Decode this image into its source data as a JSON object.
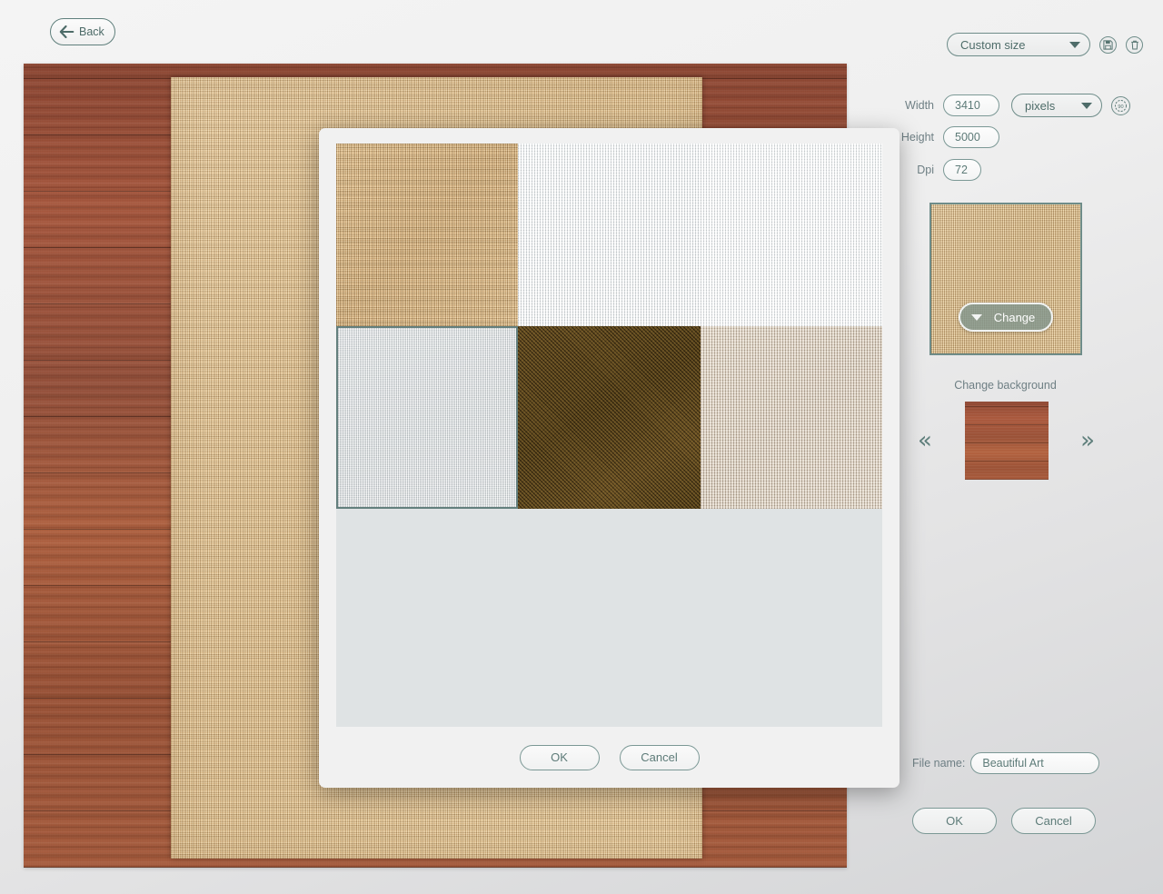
{
  "back_button": {
    "label": "Back",
    "icon": "arrow-left-icon"
  },
  "panel": {
    "size_preset": {
      "value": "Custom size",
      "icon": "chevron-down-icon"
    },
    "save_icon": "save-disk-icon",
    "delete_icon": "trash-icon",
    "rotate_icon": "rotate-90-icon",
    "rotate_icon_text": "90",
    "width": {
      "label": "Width",
      "value": "3410"
    },
    "height": {
      "label": "Height",
      "value": "5000"
    },
    "dpi": {
      "label": "Dpi",
      "value": "72"
    },
    "unit": {
      "value": "pixels",
      "icon": "chevron-down-icon"
    },
    "change_button": {
      "label": "Change",
      "icon": "caret-down-icon"
    },
    "background_label": "Change background",
    "prev_icon": "double-chevron-left-icon",
    "prev_glyph": "«",
    "next_icon": "double-chevron-right-icon",
    "next_glyph": "»",
    "file_name": {
      "label": "File name:",
      "value": "Beautiful Art"
    },
    "ok_label": "OK",
    "cancel_label": "Cancel"
  },
  "modal": {
    "ok_label": "OK",
    "cancel_label": "Cancel",
    "swatches": [
      {
        "name": "burlap-tan",
        "class": "tex-burlap-tan",
        "selected": false
      },
      {
        "name": "white-linen",
        "class": "tex-white-linen",
        "selected": false
      },
      {
        "name": "white-linen-2",
        "class": "tex-white-linen2",
        "selected": false
      },
      {
        "name": "pale-grid",
        "class": "tex-pale-grid",
        "selected": true
      },
      {
        "name": "dark-brown",
        "class": "tex-dark-brown",
        "selected": false
      },
      {
        "name": "beige-linen",
        "class": "tex-beige-linen",
        "selected": false
      }
    ]
  },
  "colors": {
    "accent": "#5f7f7c",
    "text": "#6e7f84",
    "panel_bg": "#e2e2e3",
    "modal_bg": "#f1f1f1",
    "swatch_area_bg": "#dfe3e4",
    "wood": "#a4563c",
    "burlap": "#e3c391"
  }
}
